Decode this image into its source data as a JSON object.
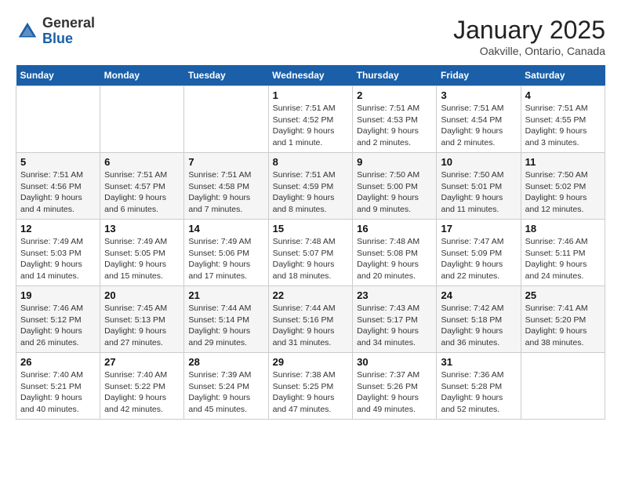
{
  "logo": {
    "general": "General",
    "blue": "Blue"
  },
  "title": "January 2025",
  "location": "Oakville, Ontario, Canada",
  "days_of_week": [
    "Sunday",
    "Monday",
    "Tuesday",
    "Wednesday",
    "Thursday",
    "Friday",
    "Saturday"
  ],
  "weeks": [
    [
      {
        "day": "",
        "info": ""
      },
      {
        "day": "",
        "info": ""
      },
      {
        "day": "",
        "info": ""
      },
      {
        "day": "1",
        "info": "Sunrise: 7:51 AM\nSunset: 4:52 PM\nDaylight: 9 hours\nand 1 minute."
      },
      {
        "day": "2",
        "info": "Sunrise: 7:51 AM\nSunset: 4:53 PM\nDaylight: 9 hours\nand 2 minutes."
      },
      {
        "day": "3",
        "info": "Sunrise: 7:51 AM\nSunset: 4:54 PM\nDaylight: 9 hours\nand 2 minutes."
      },
      {
        "day": "4",
        "info": "Sunrise: 7:51 AM\nSunset: 4:55 PM\nDaylight: 9 hours\nand 3 minutes."
      }
    ],
    [
      {
        "day": "5",
        "info": "Sunrise: 7:51 AM\nSunset: 4:56 PM\nDaylight: 9 hours\nand 4 minutes."
      },
      {
        "day": "6",
        "info": "Sunrise: 7:51 AM\nSunset: 4:57 PM\nDaylight: 9 hours\nand 6 minutes."
      },
      {
        "day": "7",
        "info": "Sunrise: 7:51 AM\nSunset: 4:58 PM\nDaylight: 9 hours\nand 7 minutes."
      },
      {
        "day": "8",
        "info": "Sunrise: 7:51 AM\nSunset: 4:59 PM\nDaylight: 9 hours\nand 8 minutes."
      },
      {
        "day": "9",
        "info": "Sunrise: 7:50 AM\nSunset: 5:00 PM\nDaylight: 9 hours\nand 9 minutes."
      },
      {
        "day": "10",
        "info": "Sunrise: 7:50 AM\nSunset: 5:01 PM\nDaylight: 9 hours\nand 11 minutes."
      },
      {
        "day": "11",
        "info": "Sunrise: 7:50 AM\nSunset: 5:02 PM\nDaylight: 9 hours\nand 12 minutes."
      }
    ],
    [
      {
        "day": "12",
        "info": "Sunrise: 7:49 AM\nSunset: 5:03 PM\nDaylight: 9 hours\nand 14 minutes."
      },
      {
        "day": "13",
        "info": "Sunrise: 7:49 AM\nSunset: 5:05 PM\nDaylight: 9 hours\nand 15 minutes."
      },
      {
        "day": "14",
        "info": "Sunrise: 7:49 AM\nSunset: 5:06 PM\nDaylight: 9 hours\nand 17 minutes."
      },
      {
        "day": "15",
        "info": "Sunrise: 7:48 AM\nSunset: 5:07 PM\nDaylight: 9 hours\nand 18 minutes."
      },
      {
        "day": "16",
        "info": "Sunrise: 7:48 AM\nSunset: 5:08 PM\nDaylight: 9 hours\nand 20 minutes."
      },
      {
        "day": "17",
        "info": "Sunrise: 7:47 AM\nSunset: 5:09 PM\nDaylight: 9 hours\nand 22 minutes."
      },
      {
        "day": "18",
        "info": "Sunrise: 7:46 AM\nSunset: 5:11 PM\nDaylight: 9 hours\nand 24 minutes."
      }
    ],
    [
      {
        "day": "19",
        "info": "Sunrise: 7:46 AM\nSunset: 5:12 PM\nDaylight: 9 hours\nand 26 minutes."
      },
      {
        "day": "20",
        "info": "Sunrise: 7:45 AM\nSunset: 5:13 PM\nDaylight: 9 hours\nand 27 minutes."
      },
      {
        "day": "21",
        "info": "Sunrise: 7:44 AM\nSunset: 5:14 PM\nDaylight: 9 hours\nand 29 minutes."
      },
      {
        "day": "22",
        "info": "Sunrise: 7:44 AM\nSunset: 5:16 PM\nDaylight: 9 hours\nand 31 minutes."
      },
      {
        "day": "23",
        "info": "Sunrise: 7:43 AM\nSunset: 5:17 PM\nDaylight: 9 hours\nand 34 minutes."
      },
      {
        "day": "24",
        "info": "Sunrise: 7:42 AM\nSunset: 5:18 PM\nDaylight: 9 hours\nand 36 minutes."
      },
      {
        "day": "25",
        "info": "Sunrise: 7:41 AM\nSunset: 5:20 PM\nDaylight: 9 hours\nand 38 minutes."
      }
    ],
    [
      {
        "day": "26",
        "info": "Sunrise: 7:40 AM\nSunset: 5:21 PM\nDaylight: 9 hours\nand 40 minutes."
      },
      {
        "day": "27",
        "info": "Sunrise: 7:40 AM\nSunset: 5:22 PM\nDaylight: 9 hours\nand 42 minutes."
      },
      {
        "day": "28",
        "info": "Sunrise: 7:39 AM\nSunset: 5:24 PM\nDaylight: 9 hours\nand 45 minutes."
      },
      {
        "day": "29",
        "info": "Sunrise: 7:38 AM\nSunset: 5:25 PM\nDaylight: 9 hours\nand 47 minutes."
      },
      {
        "day": "30",
        "info": "Sunrise: 7:37 AM\nSunset: 5:26 PM\nDaylight: 9 hours\nand 49 minutes."
      },
      {
        "day": "31",
        "info": "Sunrise: 7:36 AM\nSunset: 5:28 PM\nDaylight: 9 hours\nand 52 minutes."
      },
      {
        "day": "",
        "info": ""
      }
    ]
  ]
}
